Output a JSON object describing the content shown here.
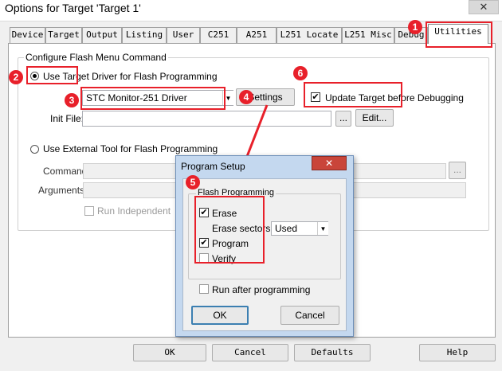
{
  "window": {
    "title": "Options for Target 'Target 1'",
    "close_glyph": "✕"
  },
  "tabs": [
    "Device",
    "Target",
    "Output",
    "Listing",
    "User",
    "C251",
    "A251",
    "L251 Locate",
    "L251 Misc",
    "Debug",
    "Utilities"
  ],
  "active_tab": "Utilities",
  "config": {
    "group_label": "Configure Flash Menu Command",
    "use_target_driver": "Use Target Driver for Flash Programming",
    "driver_value": "STC Monitor-251 Driver",
    "settings": "Settings",
    "update_target": "Update Target before Debugging",
    "init_file": "Init File:",
    "browse": "...",
    "edit": "Edit...",
    "use_external": "Use External Tool for Flash Programming",
    "command": "Command:",
    "arguments": "Arguments:",
    "run_independent": "Run Independent"
  },
  "dialog": {
    "title": "Program Setup",
    "close_glyph": "✕",
    "group_label": "Flash Programming",
    "erase": "Erase",
    "erase_sectors": "Erase sectors",
    "erase_sectors_value": "Used",
    "program": "Program",
    "verify": "Verify",
    "run_after": "Run after programming",
    "ok": "OK",
    "cancel": "Cancel"
  },
  "footer": {
    "ok": "OK",
    "cancel": "Cancel",
    "defaults": "Defaults",
    "help": "Help"
  },
  "markers": [
    "1",
    "2",
    "3",
    "4",
    "5",
    "6"
  ],
  "colors": {
    "annotation_red": "#e8202a",
    "dialog_frame": "#c4d8ef"
  },
  "checks": {
    "mark": "✔"
  }
}
